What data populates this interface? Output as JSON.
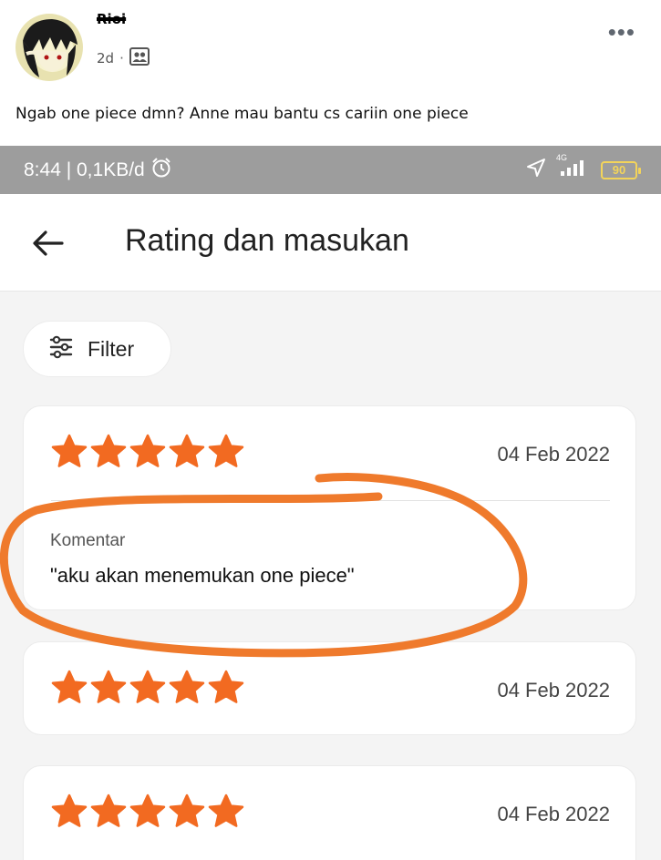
{
  "post": {
    "author_name": "Rioi",
    "time": "2d",
    "separator": "·",
    "audience_icon": "friends-icon",
    "more_icon": "•••",
    "text": "Ngab one piece dmn? Anne mau bantu cs cariin one piece"
  },
  "status_bar": {
    "time_speed": "8:44 | 0,1KB/d",
    "network": "4G",
    "battery": "90"
  },
  "app_bar": {
    "title": "Rating dan masukan"
  },
  "filter": {
    "label": "Filter"
  },
  "reviews": [
    {
      "rating": 5,
      "date": "04 Feb 2022",
      "comment_label": "Komentar",
      "comment": "\"aku akan menemukan one piece\""
    },
    {
      "rating": 5,
      "date": "04 Feb 2022"
    },
    {
      "rating": 5,
      "date": "04 Feb 2022"
    }
  ],
  "colors": {
    "star": "#f26a21",
    "annotation": "#ef7a2c",
    "status_bar": "#9d9d9d"
  }
}
